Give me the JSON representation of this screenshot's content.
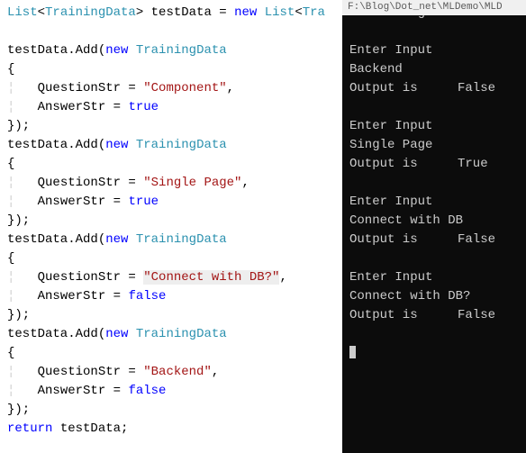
{
  "editor": {
    "decl": {
      "list": "List",
      "lt": "<",
      "gt": ">",
      "type": "TrainingData",
      "varName": " testData",
      "assign": " = ",
      "newKw": "new",
      "listCtor": " List",
      "trailType": "Tra"
    },
    "addPrefix": "testData",
    "addCall": ".Add(",
    "newKw": "new",
    "trainingData": " TrainingData",
    "openBrace": "{",
    "closeBrace": "});",
    "closeBraceOnly": "}",
    "qKey": "QuestionStr = ",
    "aKey": "AnswerStr = ",
    "trueKw": "true",
    "falseKw": "false",
    "returnKw": "return",
    "returnTail": " testData;",
    "entries": [
      {
        "q": "\"Component\"",
        "a": "true"
      },
      {
        "q": "\"Single Page\"",
        "a": "true"
      },
      {
        "q": "\"Connect with DB?\"",
        "a": "false",
        "qHighlight": true
      },
      {
        "q": "\"Backend\"",
        "a": "false"
      }
    ]
  },
  "terminal": {
    "titlebar": "F:\\Blog\\Dot_net\\MLDemo\\MLD",
    "header": "Insert angular terms",
    "prompt": "Enter Input",
    "outputLabel": "Output is",
    "sessions": [
      {
        "input": "Backend",
        "result": "False"
      },
      {
        "input": "Single Page",
        "result": "True"
      },
      {
        "input": "Connect with DB",
        "result": "False"
      },
      {
        "input": "Connect with DB?",
        "result": "False"
      }
    ]
  }
}
